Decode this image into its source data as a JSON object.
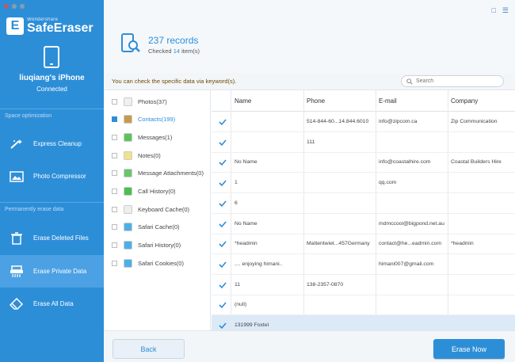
{
  "app": {
    "brand_sub": "Wondershare",
    "brand_name": "SafeEraser",
    "logo_letter": "E"
  },
  "device": {
    "name": "liuqiang's iPhone",
    "status": "Connected"
  },
  "sidebar": {
    "section1": "Space optimization",
    "section2": "Permanently erase data",
    "items": [
      {
        "label": "Express Cleanup",
        "icon": "wand-icon"
      },
      {
        "label": "Photo Compressor",
        "icon": "photo-icon"
      },
      {
        "label": "Erase Deleted Files",
        "icon": "trash-icon"
      },
      {
        "label": "Erase Private Data",
        "icon": "shredder-icon",
        "active": true
      },
      {
        "label": "Erase All Data",
        "icon": "eraser-icon"
      }
    ]
  },
  "summary": {
    "records": "237 records",
    "checked_prefix": "Checked ",
    "checked_count": "14",
    "checked_suffix": " item(s)"
  },
  "keyword": {
    "hint": "You can check the specific data via keyword(s).",
    "search_placeholder": "Search"
  },
  "categories": [
    {
      "label": "Photos(37)",
      "checked": false,
      "color": "#f0f0f0"
    },
    {
      "label": "Contacts(199)",
      "checked": true,
      "color": "#c99a4b",
      "active": true
    },
    {
      "label": "Messages(1)",
      "checked": false,
      "color": "#5cc35c"
    },
    {
      "label": "Notes(0)",
      "checked": false,
      "color": "#f2e28a"
    },
    {
      "label": "Message Attachments(0)",
      "checked": false,
      "color": "#6cc46c"
    },
    {
      "label": "Call History(0)",
      "checked": false,
      "color": "#4cbf4c"
    },
    {
      "label": "Keyboard Cache(0)",
      "checked": false,
      "color": "#eeeeee"
    },
    {
      "label": "Safari Cache(0)",
      "checked": false,
      "color": "#4ab0e8"
    },
    {
      "label": "Safari History(0)",
      "checked": false,
      "color": "#4ab0e8"
    },
    {
      "label": "Safari Cookies(0)",
      "checked": false,
      "color": "#4ab0e8"
    }
  ],
  "table": {
    "columns": [
      "Name",
      "Phone",
      "E-mail",
      "Company"
    ],
    "rows": [
      [
        "",
        "514-844-60...14.844.6010",
        "info@zipcom.ca",
        "Zip Communication"
      ],
      [
        "",
        "111",
        "",
        ""
      ],
      [
        "No Name",
        "",
        "info@coastalhire.com",
        "Coastal Builders Hire"
      ],
      [
        "1",
        "",
        "qq.com",
        ""
      ],
      [
        "6",
        "",
        "",
        ""
      ],
      [
        "No Name",
        "",
        "mdmccool@bigpond.net.au",
        ""
      ],
      [
        "*headmin",
        "Mattentwiet...457Germany",
        "contact@he...eadmin.com",
        "*headmin"
      ],
      [
        ".... enjoying himani..",
        "",
        "himani007@gmail.com",
        ""
      ],
      [
        "11",
        "138-2357-0870",
        "",
        ""
      ],
      [
        "(null)",
        "",
        "",
        ""
      ],
      [
        "131999 Foxtel",
        "",
        "",
        ""
      ]
    ]
  },
  "buttons": {
    "back": "Back",
    "erase": "Erase Now"
  },
  "colors": {
    "accent": "#2d8ed8",
    "sidebar_active": "#4ba1e3"
  }
}
